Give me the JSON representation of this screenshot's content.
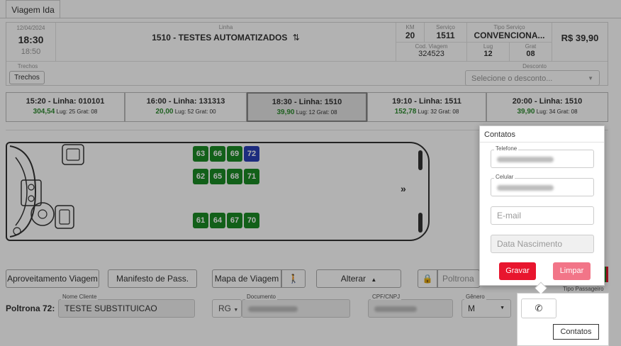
{
  "tab": {
    "label": "Viagem Ida"
  },
  "info": {
    "date": "12/04/2024",
    "time_main": "18:30",
    "time_sub": "18:50",
    "linha_label": "Linha",
    "linha_value": "1510 - TESTES AUTOMATIZADOS",
    "km_label": "KM",
    "km_value": "20",
    "servico_label": "Serviço",
    "servico_value": "1511",
    "tipo_label": "Tipo Serviço",
    "tipo_value": "CONVENCIONA...",
    "price": "R$ 39,90",
    "codviagem_label": "Cod. Viagem",
    "codviagem_value": "324523",
    "lug_label": "Lug",
    "lug_value": "12",
    "grat_label": "Grat",
    "grat_value": "08",
    "trechos_label": "Trechos",
    "trechos_button": "Trechos",
    "desconto_label": "Desconto",
    "desconto_placeholder": "Selecione o desconto..."
  },
  "schedule": [
    {
      "time": "15:20 - Linha: 010101",
      "price": "304,54",
      "meta": "Lug: 25 Grat: 08"
    },
    {
      "time": "16:00 - Linha: 131313",
      "price": "20,00",
      "meta": "Lug: 52 Grat: 00"
    },
    {
      "time": "18:30 - Linha: 1510",
      "price": "39,90",
      "meta": "Lug: 12 Grat: 08"
    },
    {
      "time": "19:10 - Linha: 1511",
      "price": "152,78",
      "meta": "Lug: 32 Grat: 08"
    },
    {
      "time": "20:00 - Linha: 1510",
      "price": "39,90",
      "meta": "Lug: 34 Grat: 08"
    }
  ],
  "seats": {
    "top": [
      "63",
      "66",
      "69",
      "72"
    ],
    "middle": [
      "62",
      "65",
      "68",
      "71"
    ],
    "bottom": [
      "61",
      "64",
      "67",
      "70"
    ]
  },
  "actions": {
    "aproveitamento": "Aproveitamento Viagem",
    "manifesto": "Manifesto de Pass.",
    "mapa": "Mapa de Viagem",
    "alterar": "Alterar",
    "poltrona_placeholder": "Poltrona"
  },
  "passenger": {
    "seat_label": "Poltrona 72:",
    "nome_label": "Nome Cliente",
    "nome_value": "TESTE SUBSTITUICAO",
    "documento_label": "Documento",
    "doc_type": "RG",
    "cpf_label": "CPF/CNPJ",
    "genero_label": "Gênero",
    "genero_value": "M",
    "tipo_passageiro_label": "Tipo Passageiro"
  },
  "contatos": {
    "title": "Contatos",
    "telefone_label": "Telefone",
    "celular_label": "Celular",
    "email_placeholder": "E-mail",
    "nascimento_placeholder": "Data Nascimento",
    "gravar": "Gravar",
    "limpar": "Limpar",
    "tooltip": "Contatos"
  },
  "colors": {
    "seat_green": "#1b8a25",
    "seat_selected": "#2a3fb5",
    "price_green": "#2e8b30",
    "gravar_red": "#e8152e",
    "limpar_pink": "#f27588"
  }
}
